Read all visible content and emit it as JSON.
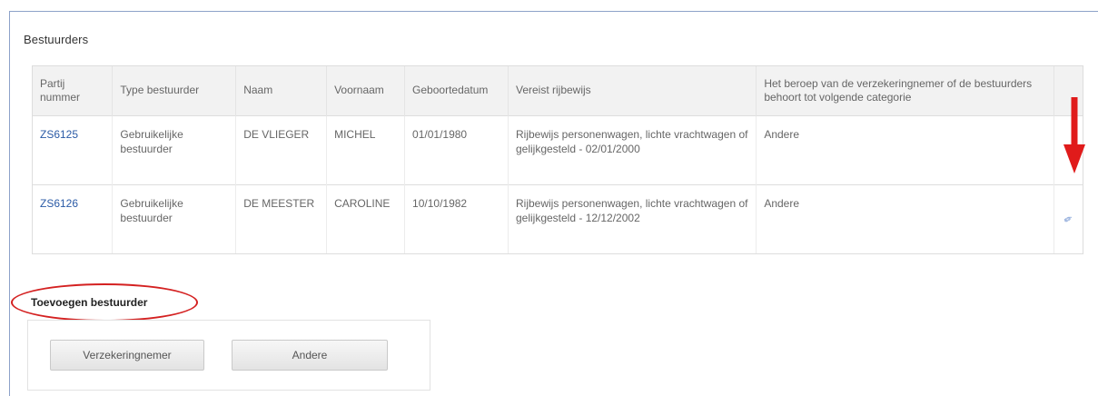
{
  "section": {
    "title": "Bestuurders"
  },
  "table": {
    "headers": {
      "party": "Partij nummer",
      "type": "Type bestuurder",
      "name": "Naam",
      "firstname": "Voornaam",
      "dob": "Geboortedatum",
      "license": "Vereist rijbewijs",
      "profession": "Het beroep van de verzekeringnemer of de bestuurders behoort tot volgende categorie"
    },
    "rows": [
      {
        "party": "ZS6125",
        "type": "Gebruikelijke bestuurder",
        "name": "DE VLIEGER",
        "firstname": "MICHEL",
        "dob": "01/01/1980",
        "license": "Rijbewijs personenwagen, lichte vrachtwagen of gelijkgesteld - 02/01/2000",
        "profession": "Andere"
      },
      {
        "party": "ZS6126",
        "type": "Gebruikelijke bestuurder",
        "name": "DE MEESTER",
        "firstname": "CAROLINE",
        "dob": "10/10/1982",
        "license": "Rijbewijs personenwagen, lichte vrachtwagen of gelijkgesteld - 12/12/2002",
        "profession": "Andere"
      }
    ]
  },
  "add_section": {
    "title": "Toevoegen bestuurder",
    "buttons": {
      "policyholder": "Verzekeringnemer",
      "other": "Andere"
    }
  },
  "icons": {
    "edit": "pencil-icon",
    "annotation_arrow": "red-down-arrow"
  },
  "colors": {
    "link": "#2a5aa6",
    "annotation": "#d42121",
    "frame_border": "#8da2c9"
  }
}
